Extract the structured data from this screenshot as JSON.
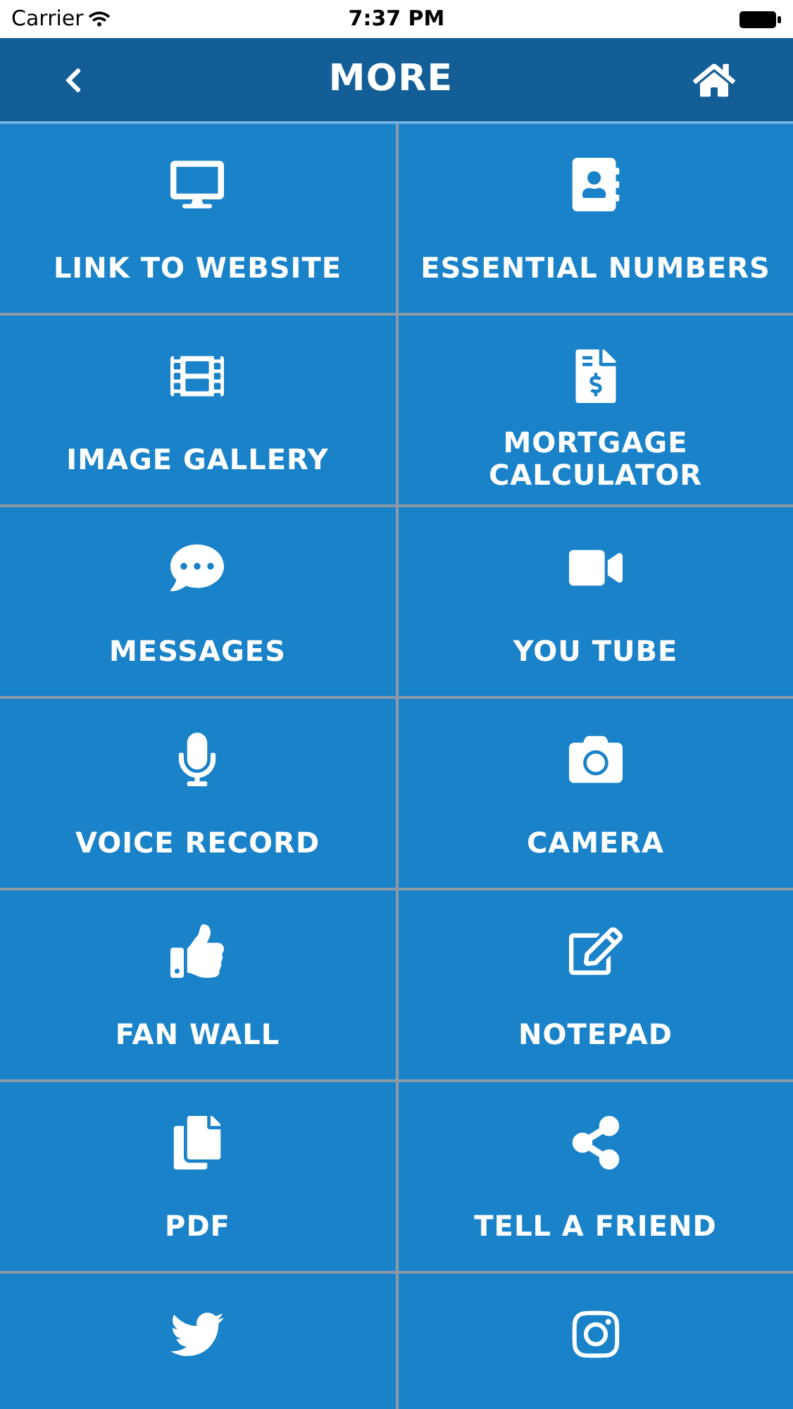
{
  "status_bar": {
    "carrier": "Carrier",
    "time": "7:37 PM"
  },
  "nav": {
    "title": "MORE"
  },
  "tiles": [
    {
      "label": "LINK TO WEBSITE"
    },
    {
      "label": "ESSENTIAL NUMBERS"
    },
    {
      "label": "IMAGE GALLERY"
    },
    {
      "label": "MORTGAGE CALCULATOR"
    },
    {
      "label": "MESSAGES"
    },
    {
      "label": "YOU TUBE"
    },
    {
      "label": "VOICE RECORD"
    },
    {
      "label": "CAMERA"
    },
    {
      "label": "FAN WALL"
    },
    {
      "label": "NOTEPAD"
    },
    {
      "label": "PDF"
    },
    {
      "label": "TELL A FRIEND"
    }
  ]
}
